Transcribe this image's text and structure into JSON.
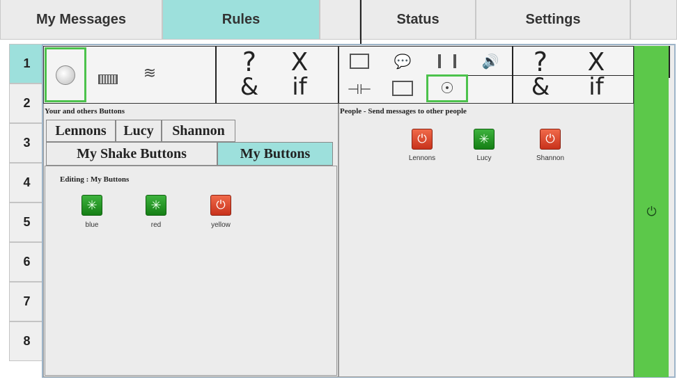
{
  "top_tabs": [
    {
      "label": "My Messages",
      "active": false
    },
    {
      "label": "Rules",
      "active": true
    },
    {
      "label": "",
      "active": false
    },
    {
      "label": "Status",
      "active": false
    },
    {
      "label": "Settings",
      "active": false
    },
    {
      "label": "",
      "active": false
    }
  ],
  "side_tabs": [
    {
      "label": "1",
      "active": true
    },
    {
      "label": "2"
    },
    {
      "label": "3"
    },
    {
      "label": "4"
    },
    {
      "label": "5"
    },
    {
      "label": "6"
    },
    {
      "label": "7"
    },
    {
      "label": "8"
    }
  ],
  "left_panel": {
    "toolbar": {
      "question": "?",
      "cross": "X",
      "amp": "&",
      "if": "if"
    },
    "heading": "Your and others Buttons",
    "person_tabs": [
      "Lennons",
      "Lucy",
      "Shannon"
    ],
    "button_tabs": [
      {
        "label": "My Shake Buttons",
        "active": false
      },
      {
        "label": "My Buttons",
        "active": true
      }
    ],
    "editing_heading": "Editing : My Buttons",
    "buttons": [
      {
        "label": "blue",
        "type": "green"
      },
      {
        "label": "red",
        "type": "green"
      },
      {
        "label": "yellow",
        "type": "red"
      }
    ]
  },
  "right_panel": {
    "toolbar": {
      "question": "?",
      "cross": "X",
      "amp": "&",
      "if": "if"
    },
    "heading": "People - Send messages to other people",
    "people": [
      {
        "label": "Lennons",
        "type": "red"
      },
      {
        "label": "Lucy",
        "type": "green"
      },
      {
        "label": "Shannon",
        "type": "red"
      }
    ]
  },
  "power_bar": {
    "icon": "power-icon",
    "color": "#5cc84a"
  },
  "colors": {
    "accent": "#9de0dc",
    "selection": "#4cc24c",
    "green_bar": "#5cc84a"
  }
}
